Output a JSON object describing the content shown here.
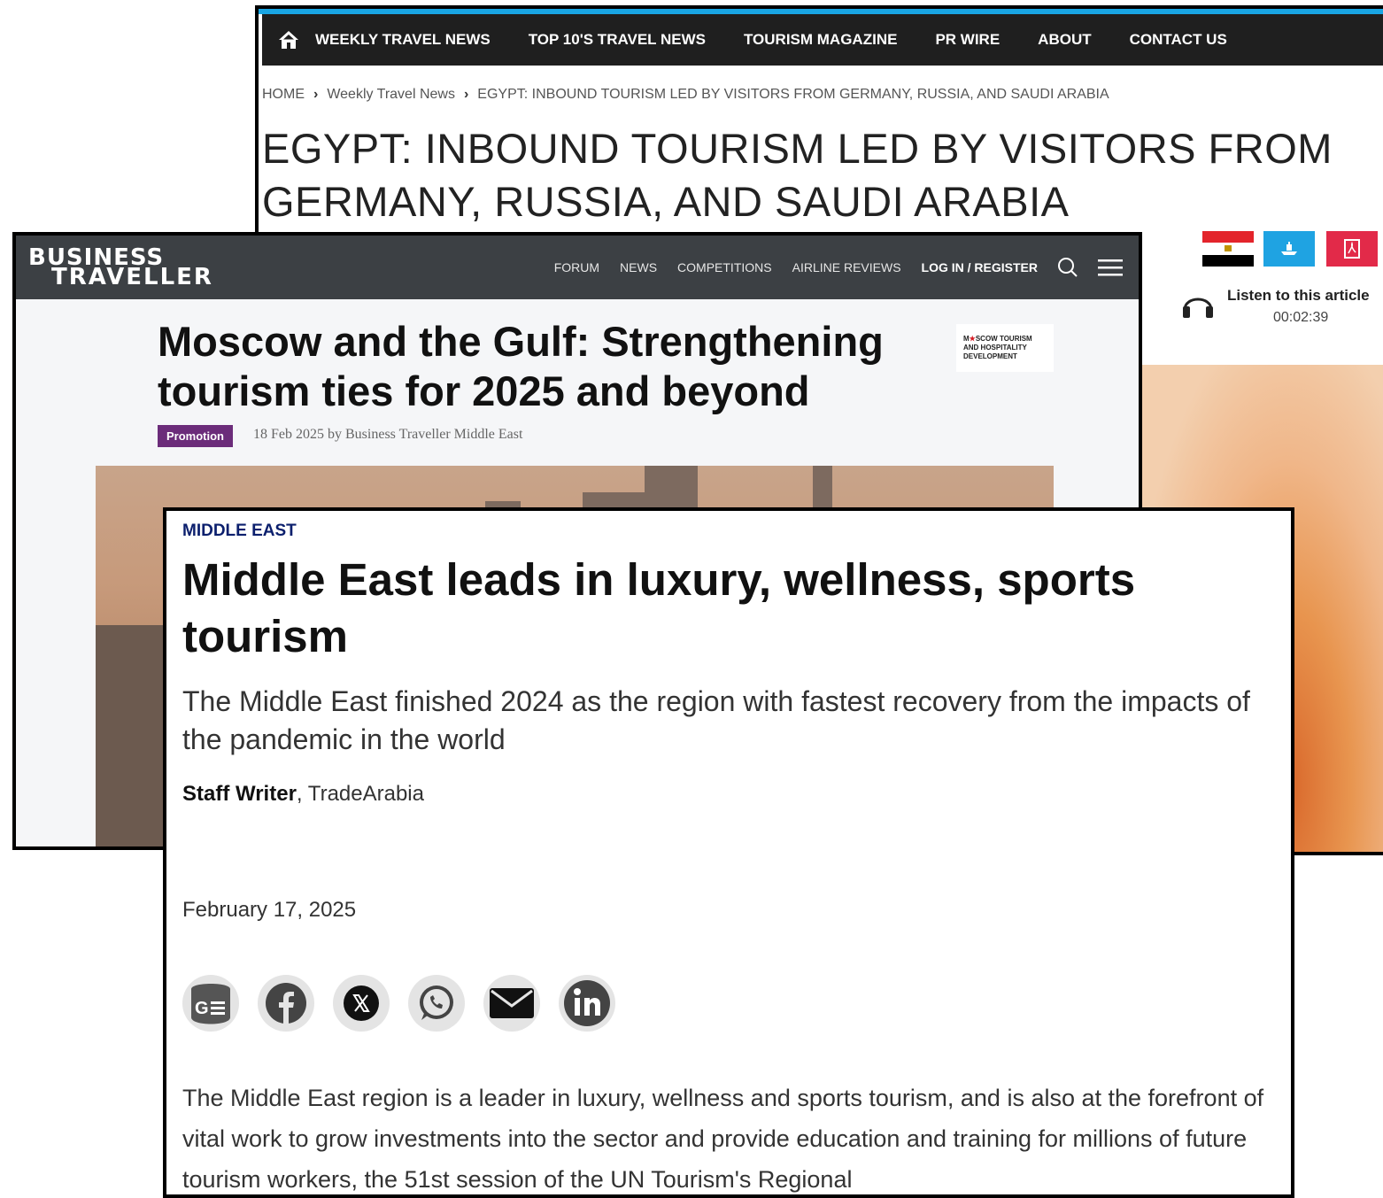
{
  "egypt": {
    "nav": [
      "WEEKLY TRAVEL NEWS",
      "TOP 10'S TRAVEL NEWS",
      "TOURISM MAGAZINE",
      "PR WIRE",
      "ABOUT",
      "CONTACT US"
    ],
    "breadcrumb": [
      "HOME",
      "Weekly Travel News",
      "EGYPT: INBOUND TOURISM LED BY VISITORS FROM GERMANY, RUSSIA, AND SAUDI ARABIA"
    ],
    "title": "EGYPT: INBOUND TOURISM LED BY VISITORS FROM GERMANY, RUSSIA, AND SAUDI ARABIA",
    "listen_label": "Listen to this article",
    "listen_time": "00:02:39",
    "colors": {
      "accent": "#19a6e4",
      "nav_bg": "#1f1f1f",
      "share_blue": "#1fa3e2",
      "pdf_red": "#e22a49"
    }
  },
  "bt": {
    "logo_line1": "BUSINESS",
    "logo_line2": "TRAVELLER",
    "menu": [
      "FORUM",
      "NEWS",
      "COMPETITIONS",
      "AIRLINE REVIEWS"
    ],
    "login": "LOG IN / REGISTER",
    "title": "Moscow and the Gulf: Strengthening tourism ties for 2025 and beyond",
    "sponsor": [
      "M",
      "SCOW TOURISM",
      "AND HOSPITALITY",
      "DEVELOPMENT"
    ],
    "tag": "Promotion",
    "meta": "18 Feb 2025 by Business Traveller Middle East",
    "colors": {
      "bar": "#3c4044",
      "tag": "#6b2c7a"
    }
  },
  "ta": {
    "category": "MIDDLE EAST",
    "title": "Middle East leads in luxury, wellness, sports tourism",
    "subtitle": "The Middle East finished 2024 as the region with fastest recovery from the impacts of the pandemic in the world",
    "author": "Staff Writer",
    "source": ", TradeArabia",
    "date": "February 17, 2025",
    "share_icons": [
      "google-news-icon",
      "facebook-icon",
      "x-icon",
      "whatsapp-icon",
      "email-icon",
      "linkedin-icon"
    ],
    "body": "The Middle East region is a leader in luxury, wellness and sports tourism, and is also at the forefront of vital work to grow investments into the sector and provide education and training for millions of future tourism workers, the 51st session of the UN Tourism's Regional"
  }
}
